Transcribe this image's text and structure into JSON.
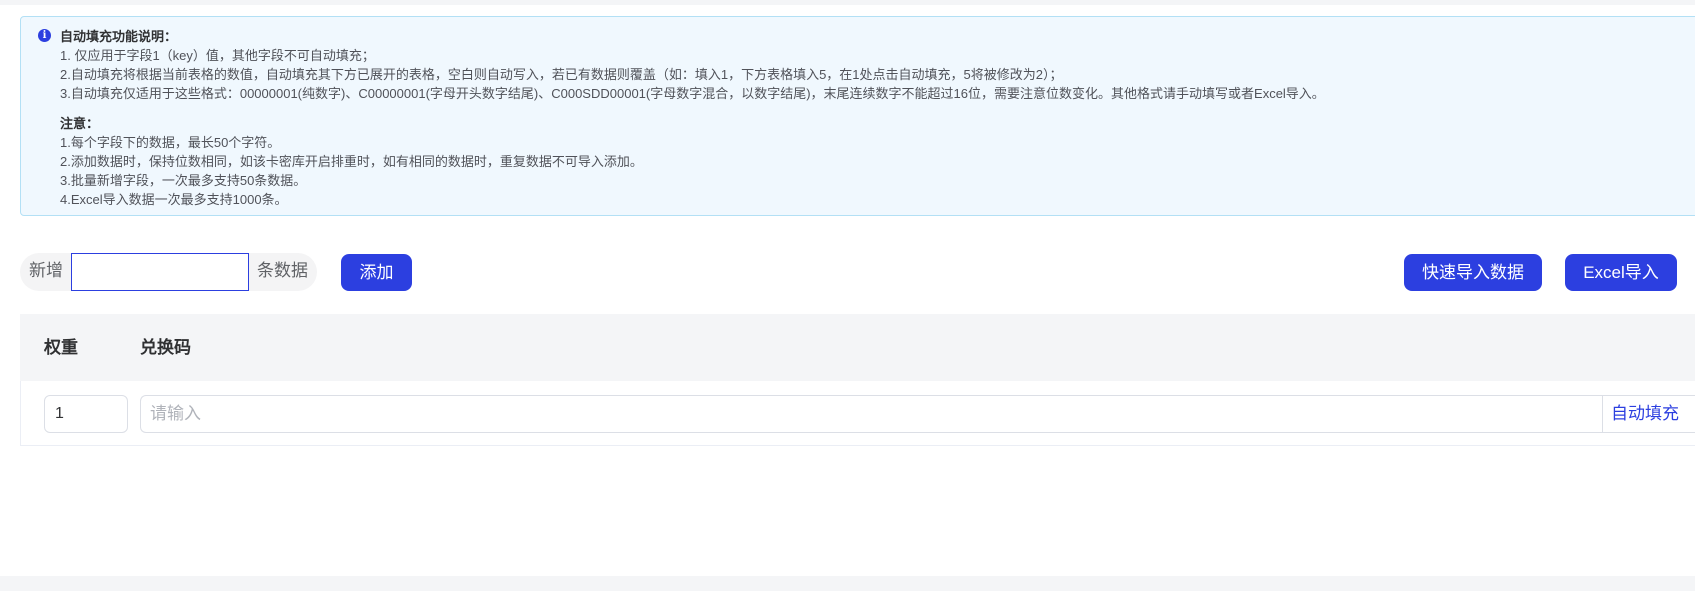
{
  "notice": {
    "title": "自动填充功能说明：",
    "lines": [
      "1. 仅应用于字段1（key）值，其他字段不可自动填充；",
      "2.自动填充将根据当前表格的数值，自动填充其下方已展开的表格，空白则自动写入，若已有数据则覆盖（如：填入1，下方表格填入5，在1处点击自动填充，5将被修改为2）；",
      "3.自动填充仅适用于这些格式：00000001(纯数字)、C00000001(字母开头数字结尾)、C000SDD00001(字母数字混合，以数字结尾)，末尾连续数字不能超过16位，需要注意位数变化。其他格式请手动填写或者Excel导入。"
    ],
    "caution_title": "注意：",
    "caution_lines": [
      "1.每个字段下的数据，最长50个字符。",
      "2.添加数据时，保持位数相同，如该卡密库开启排重时，如有相同的数据时，重复数据不可导入添加。",
      "3.批量新增字段，一次最多支持50条数据。",
      "4.Excel导入数据一次最多支持1000条。"
    ]
  },
  "add_row": {
    "prefix": "新增",
    "input_value": "",
    "suffix": "条数据",
    "add_button": "添加"
  },
  "actions": {
    "quick_import": "快速导入数据",
    "excel_import": "Excel导入"
  },
  "table": {
    "headers": {
      "weight": "权重",
      "code": "兑换码"
    },
    "rows": [
      {
        "weight": "1",
        "code_value": "",
        "code_placeholder": "请输入",
        "autofill": "自动填充"
      }
    ]
  },
  "colors": {
    "primary": "#2c3fe0",
    "notice_bg": "#f0f8fe",
    "notice_border": "#b3e0f5",
    "header_bg": "#f4f5f7"
  }
}
